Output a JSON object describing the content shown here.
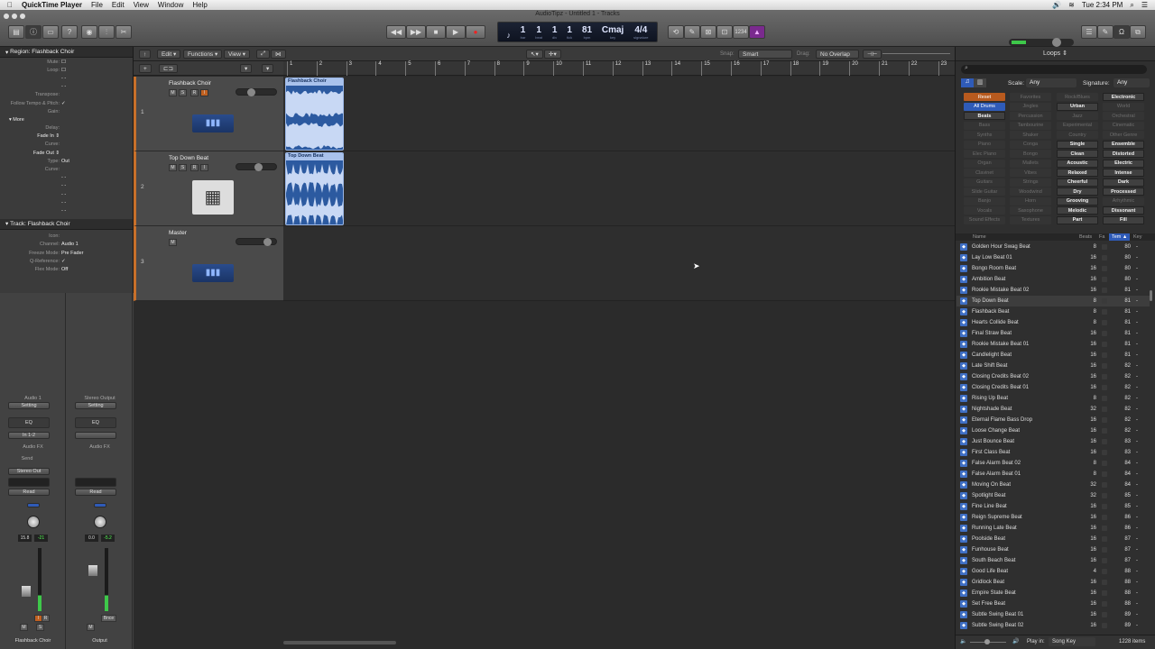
{
  "menubar": {
    "app": "QuickTime Player",
    "items": [
      "File",
      "Edit",
      "View",
      "Window",
      "Help"
    ],
    "clock": "Tue 2:34 PM"
  },
  "window": {
    "title": "AudioTipz - Untitled 1 - Tracks"
  },
  "lcd": {
    "fields": [
      {
        "v": "1",
        "l": "bar"
      },
      {
        "v": "1",
        "l": "beat"
      },
      {
        "v": "1",
        "l": "div"
      },
      {
        "v": "1",
        "l": "tick"
      },
      {
        "v": "81",
        "l": "bpm"
      },
      {
        "v": "Cmaj",
        "l": "key"
      },
      {
        "v": "4/4",
        "l": "signature"
      }
    ]
  },
  "toolbar": {
    "count_in": "1234"
  },
  "inspector": {
    "region_title": "Region: Flashback Choir",
    "region_params": [
      {
        "k": "Mute:",
        "v": "☐"
      },
      {
        "k": "Loop:",
        "v": "☐"
      },
      {
        "k": "",
        "v": "- -"
      },
      {
        "k": "",
        "v": "- -"
      },
      {
        "k": "Transpose:",
        "v": ""
      },
      {
        "k": "Follow Tempo & Pitch:",
        "v": "✓"
      },
      {
        "k": "Gain:",
        "v": ""
      }
    ],
    "more_label": "More",
    "more_params": [
      {
        "k": "Delay:",
        "v": ""
      },
      {
        "k": "Fade In ⇕",
        "v": "",
        "b": true
      },
      {
        "k": "Curve:",
        "v": ""
      },
      {
        "k": "Fade Out ⇕",
        "v": "",
        "b": true
      },
      {
        "k": "Type:",
        "v": "Out"
      },
      {
        "k": "Curve:",
        "v": ""
      },
      {
        "k": "",
        "v": "- -"
      },
      {
        "k": "",
        "v": "- -"
      },
      {
        "k": "",
        "v": "- -"
      },
      {
        "k": "",
        "v": "- -"
      },
      {
        "k": "",
        "v": "- -"
      }
    ],
    "track_title": "Track: Flashback Choir",
    "track_params": [
      {
        "k": "Icon:",
        "v": ""
      },
      {
        "k": "Channel:",
        "v": "Audio 1"
      },
      {
        "k": "Freeze Mode:",
        "v": "Pre Fader"
      },
      {
        "k": "Q-Reference:",
        "v": "✓"
      },
      {
        "k": "Flex Mode:",
        "v": "Off"
      }
    ]
  },
  "mixer": {
    "strips": [
      {
        "top": "Audio 1",
        "setting": "Setting",
        "eq": "EQ",
        "input": "In 1-2",
        "fx": "Audio FX",
        "send": "Send",
        "output": "Stereo Out",
        "auto": "Read",
        "vol": "15.8",
        "peak": "-21",
        "name": "Flashback Choir",
        "btns": [
          "I",
          "R",
          "M",
          "S"
        ]
      },
      {
        "top": "Stereo Output",
        "setting": "Setting",
        "eq": "EQ",
        "input": "",
        "fx": "Audio FX",
        "send": "",
        "output": "",
        "auto": "Read",
        "vol": "0.0",
        "peak": "-5.2",
        "name": "Output",
        "btns": [
          "Bnce",
          "M"
        ]
      }
    ]
  },
  "tracks_toolbar": {
    "edit": "Edit",
    "functions": "Functions",
    "view": "View",
    "snap_label": "Snap:",
    "snap": "Smart",
    "drag_label": "Drag:",
    "drag": "No Overlap"
  },
  "ruler": [
    "1",
    "2",
    "3",
    "4",
    "5",
    "6",
    "7",
    "8",
    "9",
    "10",
    "11",
    "12",
    "13",
    "14",
    "15",
    "16",
    "17",
    "18",
    "19",
    "20",
    "21",
    "22",
    "23"
  ],
  "tracks": [
    {
      "num": "1",
      "name": "Flashback Choir",
      "buttons": [
        "M",
        "S",
        "R",
        "I"
      ],
      "region": "Flashback Choir",
      "volume": 0.3
    },
    {
      "num": "2",
      "name": "Top Down Beat",
      "buttons": [
        "M",
        "S",
        "R",
        "I"
      ],
      "region": "Top Down Beat",
      "volume": 0.5
    },
    {
      "num": "3",
      "name": "Master",
      "buttons": [
        "M"
      ],
      "volume": 0.75
    }
  ],
  "loops": {
    "title": "Loops",
    "scale_label": "Scale:",
    "scale": "Any",
    "signature_label": "Signature:",
    "signature": "Any",
    "keywords": [
      [
        "Reset",
        "reset"
      ],
      [
        "Favorites",
        "dim"
      ],
      [
        "Rock/Blues",
        "dim"
      ],
      [
        "Electronic",
        "bold"
      ],
      [
        "All Drums",
        "sel"
      ],
      [
        "Jingles",
        "dim"
      ],
      [
        "Urban",
        "bold"
      ],
      [
        "World",
        "dim"
      ],
      [
        "Beats",
        "bold"
      ],
      [
        "Percussion",
        "dim"
      ],
      [
        "Jazz",
        "dim"
      ],
      [
        "Orchestral",
        "dim"
      ],
      [
        "Bass",
        "dim"
      ],
      [
        "Tambourine",
        "dim"
      ],
      [
        "Experimental",
        "dim"
      ],
      [
        "Cinematic",
        "dim"
      ],
      [
        "Synths",
        "dim"
      ],
      [
        "Shaker",
        "dim"
      ],
      [
        "Country",
        "dim"
      ],
      [
        "Other Genre",
        "dim"
      ],
      [
        "Piano",
        "dim"
      ],
      [
        "Conga",
        "dim"
      ],
      [
        "Single",
        "bold"
      ],
      [
        "Ensemble",
        "bold"
      ],
      [
        "Elec Piano",
        "dim"
      ],
      [
        "Bongo",
        "dim"
      ],
      [
        "Clean",
        "bold"
      ],
      [
        "Distorted",
        "bold"
      ],
      [
        "Organ",
        "dim"
      ],
      [
        "Mallets",
        "dim"
      ],
      [
        "Acoustic",
        "bold"
      ],
      [
        "Electric",
        "bold"
      ],
      [
        "Clavinet",
        "dim"
      ],
      [
        "Vibes",
        "dim"
      ],
      [
        "Relaxed",
        "bold"
      ],
      [
        "Intense",
        "bold"
      ],
      [
        "Guitars",
        "dim"
      ],
      [
        "Strings",
        "dim"
      ],
      [
        "Cheerful",
        "bold"
      ],
      [
        "Dark",
        "bold"
      ],
      [
        "Slide Guitar",
        "dim"
      ],
      [
        "Woodwind",
        "dim"
      ],
      [
        "Dry",
        "bold"
      ],
      [
        "Processed",
        "bold"
      ],
      [
        "Banjo",
        "dim"
      ],
      [
        "Horn",
        "dim"
      ],
      [
        "Grooving",
        "bold"
      ],
      [
        "Arhythmic",
        "dim"
      ],
      [
        "Vocals",
        "dim"
      ],
      [
        "Saxophone",
        "dim"
      ],
      [
        "Melodic",
        "bold"
      ],
      [
        "Dissonant",
        "bold"
      ],
      [
        "Sound Effects",
        "dim"
      ],
      [
        "Textures",
        "dim"
      ],
      [
        "Part",
        "bold"
      ],
      [
        "Fill",
        "bold"
      ]
    ],
    "columns": [
      "Name",
      "Beats",
      "Fa",
      "Tem ▲",
      "Key"
    ],
    "items": [
      [
        "Golden Hour Swag Beat",
        "8",
        "80"
      ],
      [
        "Lay Low Beat 01",
        "16",
        "80"
      ],
      [
        "Bongo Room Beat",
        "16",
        "80"
      ],
      [
        "Ambition Beat",
        "16",
        "80"
      ],
      [
        "Rookie Mistake Beat 02",
        "16",
        "81"
      ],
      [
        "Top Down Beat",
        "8",
        "81"
      ],
      [
        "Flashback Beat",
        "8",
        "81"
      ],
      [
        "Hearts Collide Beat",
        "8",
        "81"
      ],
      [
        "Final Straw Beat",
        "16",
        "81"
      ],
      [
        "Rookie Mistake Beat 01",
        "16",
        "81"
      ],
      [
        "Candlelight Beat",
        "16",
        "81"
      ],
      [
        "Late Shift Beat",
        "16",
        "82"
      ],
      [
        "Closing Credits Beat 02",
        "16",
        "82"
      ],
      [
        "Closing Credits Beat 01",
        "16",
        "82"
      ],
      [
        "Rising Up Beat",
        "8",
        "82"
      ],
      [
        "Nightshade Beat",
        "32",
        "82"
      ],
      [
        "Eternal Flame Bass Drop",
        "16",
        "82"
      ],
      [
        "Loose Change Beat",
        "16",
        "82"
      ],
      [
        "Just Bounce Beat",
        "16",
        "83"
      ],
      [
        "First Class Beat",
        "16",
        "83"
      ],
      [
        "False Alarm Beat 02",
        "8",
        "84"
      ],
      [
        "False Alarm Beat 01",
        "8",
        "84"
      ],
      [
        "Moving On Beat",
        "32",
        "84"
      ],
      [
        "Spotlight Beat",
        "32",
        "85"
      ],
      [
        "Fine Line Beat",
        "16",
        "85"
      ],
      [
        "Reign Supreme Beat",
        "16",
        "86"
      ],
      [
        "Running Late Beat",
        "16",
        "86"
      ],
      [
        "Poolside Beat",
        "16",
        "87"
      ],
      [
        "Funhouse Beat",
        "16",
        "87"
      ],
      [
        "South Beach Beat",
        "16",
        "87"
      ],
      [
        "Good Life Beat",
        "4",
        "88"
      ],
      [
        "Gridlock Beat",
        "16",
        "88"
      ],
      [
        "Empire State Beat",
        "16",
        "88"
      ],
      [
        "Set Free Beat",
        "16",
        "88"
      ],
      [
        "Subtle Swing Beat 01",
        "16",
        "89"
      ],
      [
        "Subtle Swing Beat 02",
        "16",
        "89"
      ]
    ],
    "highlight_index": 5,
    "key_value": "-",
    "play_in_label": "Play in:",
    "play_in": "Song Key",
    "count": "1228 items"
  }
}
